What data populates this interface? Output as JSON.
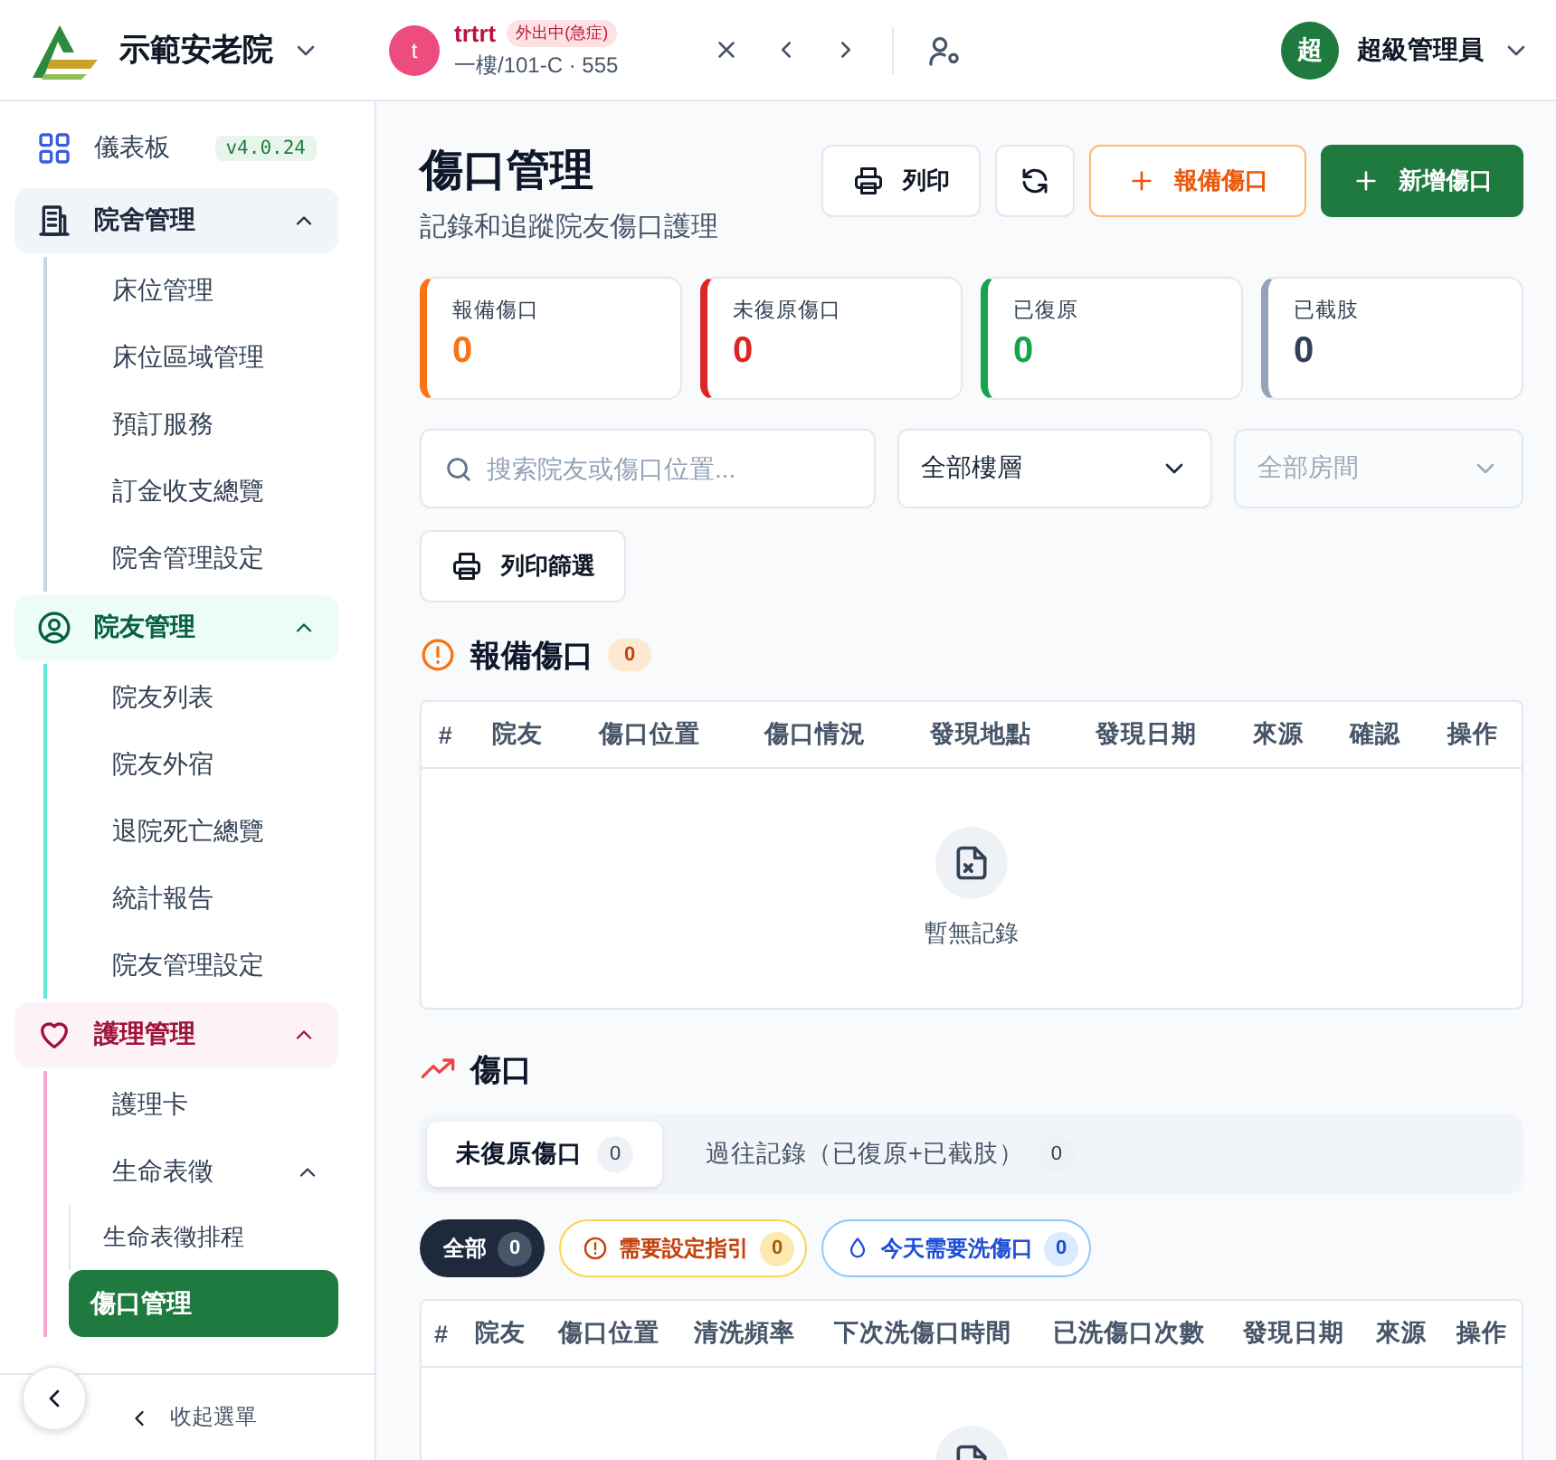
{
  "header": {
    "org": "示範安老院",
    "resident": {
      "avatar": "t",
      "name": "trtrt",
      "status": "外出中(急症)",
      "location": "一樓/101-C · 555"
    },
    "user": {
      "avatar": "超",
      "name": "超級管理員"
    }
  },
  "sidebar": {
    "dashboard": {
      "label": "儀表板",
      "version": "v4.0.24"
    },
    "groups": [
      {
        "kind": "building",
        "label": "院舍管理",
        "expanded": true,
        "children": [
          {
            "label": "床位管理",
            "selected": false
          },
          {
            "label": "床位區域管理",
            "selected": false
          },
          {
            "label": "預訂服務",
            "selected": false
          },
          {
            "label": "訂金收支總覽",
            "selected": false
          },
          {
            "label": "院舍管理設定",
            "selected": false
          }
        ]
      },
      {
        "kind": "resident",
        "label": "院友管理",
        "expanded": true,
        "children": [
          {
            "label": "院友列表",
            "selected": false
          },
          {
            "label": "院友外宿",
            "selected": false
          },
          {
            "label": "退院死亡總覽",
            "selected": false
          },
          {
            "label": "統計報告",
            "selected": false
          },
          {
            "label": "院友管理設定",
            "selected": false
          }
        ]
      },
      {
        "kind": "care",
        "label": "護理管理",
        "expanded": true,
        "children": [
          {
            "label": "護理卡",
            "selected": false
          },
          {
            "label": "生命表徵",
            "selected": false,
            "expanded": true,
            "children": [
              {
                "label": "生命表徵排程",
                "selected": false
              }
            ]
          },
          {
            "label": "傷口管理",
            "selected": true
          }
        ]
      }
    ],
    "collapse": "收起選單"
  },
  "page": {
    "title": "傷口管理",
    "subtitle": "記錄和追蹤院友傷口護理",
    "actions": [
      {
        "kind": "print",
        "label": "列印"
      },
      {
        "kind": "refresh"
      },
      {
        "kind": "report",
        "label": "報備傷口"
      },
      {
        "kind": "add",
        "label": "新增傷口"
      }
    ],
    "stats": [
      {
        "label": "報備傷口",
        "value": "0",
        "color": "#f97316"
      },
      {
        "label": "未復原傷口",
        "value": "0",
        "color": "#dc2626"
      },
      {
        "label": "已復原",
        "value": "0",
        "color": "#16a34a"
      },
      {
        "label": "已截肢",
        "value": "0",
        "color": "#94a3b8"
      }
    ],
    "filters": {
      "search": {
        "placeholder": "搜索院友或傷口位置..."
      },
      "floor": {
        "value": "全部樓層",
        "disabled": false
      },
      "room": {
        "placeholder": "全部房間",
        "disabled": true
      },
      "print": "列印篩選"
    },
    "reported": {
      "title": "報備傷口",
      "count": "0",
      "columns": [
        "#",
        "院友",
        "傷口位置",
        "傷口情況",
        "發現地點",
        "發現日期",
        "來源",
        "確認",
        "操作"
      ],
      "empty": "暫無記錄"
    },
    "wounds": {
      "title": "傷口",
      "tabs": [
        {
          "label": "未復原傷口",
          "count": "0",
          "selected": true
        },
        {
          "label": "過往記錄（已復原+已截肢）",
          "count": "0",
          "selected": false
        }
      ],
      "chips": [
        {
          "kind": "all",
          "label": "全部",
          "count": "0",
          "selected": true
        },
        {
          "kind": "warning",
          "label": "需要設定指引",
          "count": "0",
          "selected": false
        },
        {
          "kind": "wash",
          "label": "今天需要洗傷口",
          "count": "0",
          "selected": false
        }
      ],
      "columns": [
        "#",
        "院友",
        "傷口位置",
        "清洗頻率",
        "下次洗傷口時間",
        "已洗傷口次數",
        "發現日期",
        "來源",
        "操作"
      ]
    }
  }
}
